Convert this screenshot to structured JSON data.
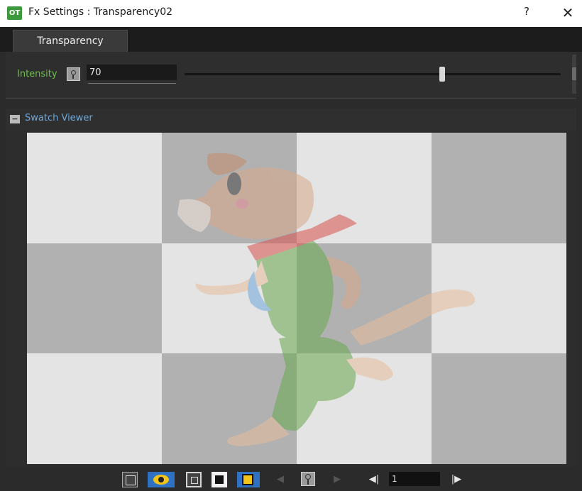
{
  "window": {
    "app_icon_text": "OT",
    "title": "Fx Settings : Transparency02",
    "help_label": "?",
    "close_label": "✕"
  },
  "tabs": [
    {
      "label": "Transparency",
      "active": true
    }
  ],
  "params": {
    "intensity_label": "Intensity",
    "intensity_value": "70",
    "slider_value": 70,
    "slider_max": 100
  },
  "swatch": {
    "collapse_symbol": "−",
    "title": "Swatch Viewer",
    "checker_light": "#e4e4e4",
    "checker_dark": "#b1b1b1"
  },
  "toolbar": {
    "icons": [
      {
        "name": "fit-to-window-icon"
      },
      {
        "name": "preview-eye-icon",
        "active": true,
        "color": "#f2c41a"
      },
      {
        "name": "white-background-icon"
      },
      {
        "name": "black-background-icon"
      },
      {
        "name": "checkerboard-background-icon",
        "active": true
      },
      {
        "name": "previous-key-icon"
      },
      {
        "name": "keyframe-icon"
      },
      {
        "name": "next-key-icon"
      },
      {
        "name": "first-frame-icon"
      },
      {
        "name": "last-frame-icon"
      }
    ],
    "prev_key_glyph": "◀",
    "next_key_glyph": "▶",
    "first_frame_glyph": "◀|",
    "last_frame_glyph": "|▶",
    "frame_value": "1"
  },
  "colors": {
    "accent_green": "#6cc04a",
    "accent_blue": "#6fa8dc",
    "toggle_blue": "#2f72c4"
  }
}
